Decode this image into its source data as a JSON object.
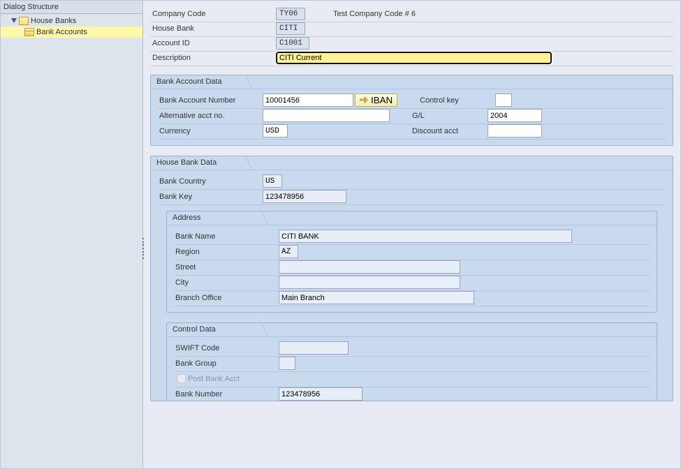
{
  "sidebar": {
    "header": "Dialog Structure",
    "root": {
      "label": "House Banks"
    },
    "child": {
      "label": "Bank Accounts"
    }
  },
  "header": {
    "company_code_label": "Company Code",
    "company_code": "TY06",
    "company_code_text": "Test Company Code # 6",
    "house_bank_label": "House Bank",
    "house_bank": "CITI",
    "account_id_label": "Account ID",
    "account_id": "C1001",
    "description_label": "Description",
    "description": "CITI Current"
  },
  "bank_account_data": {
    "title": "Bank Account Data",
    "bank_account_number_label": "Bank Account Number",
    "bank_account_number": "10001456",
    "iban_button": "IBAN",
    "control_key_label": "Control key",
    "control_key": "",
    "alt_acct_label": "Alternative acct no.",
    "alt_acct": "",
    "gl_label": "G/L",
    "gl": "2004",
    "currency_label": "Currency",
    "currency": "USD",
    "discount_acct_label": "Discount acct",
    "discount_acct": ""
  },
  "house_bank_data": {
    "title": "House Bank Data",
    "bank_country_label": "Bank Country",
    "bank_country": "US",
    "bank_key_label": "Bank Key",
    "bank_key": "123478956"
  },
  "address": {
    "title": "Address",
    "bank_name_label": "Bank Name",
    "bank_name": "CITI BANK",
    "region_label": "Region",
    "region": "AZ",
    "street_label": "Street",
    "street": "",
    "city_label": "City",
    "city": "",
    "branch_office_label": "Branch Office",
    "branch_office": "Main Branch"
  },
  "control_data": {
    "title": "Control Data",
    "swift_code_label": "SWIFT Code",
    "swift_code": "",
    "bank_group_label": "Bank Group",
    "bank_group": "",
    "post_bank_acct_label": "Post Bank Acct",
    "bank_number_label": "Bank Number",
    "bank_number": "123478956"
  }
}
